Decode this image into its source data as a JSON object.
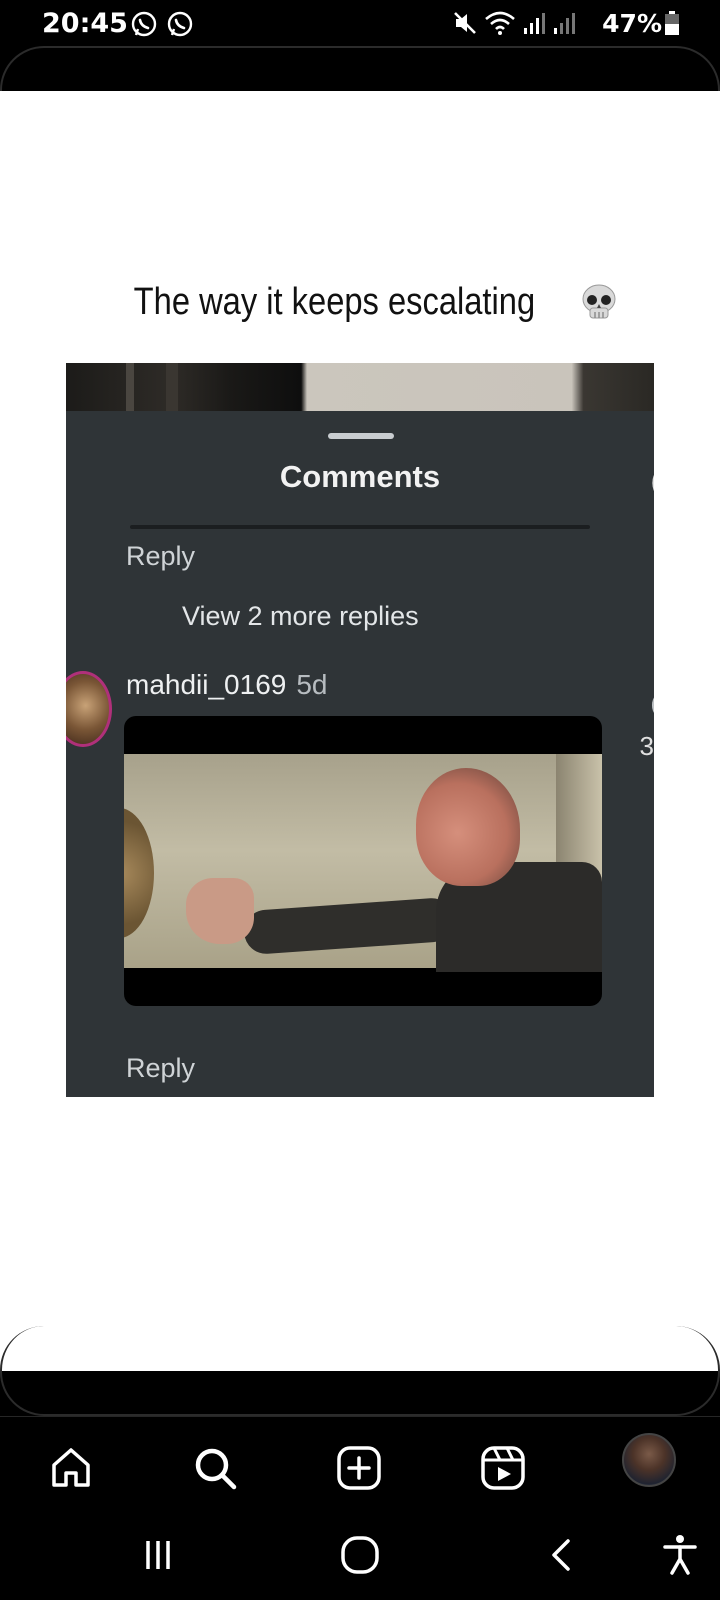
{
  "status_bar": {
    "time": "20:45",
    "battery_percent": "47%"
  },
  "post": {
    "caption": "The way it keeps escalating",
    "caption_emoji": "skull-emoji"
  },
  "embedded_screenshot": {
    "sheet_title": "Comments",
    "reply_label_1": "Reply",
    "view_more_replies": "View 2 more replies",
    "comment_username": "mahdii_0169",
    "comment_age": "5d",
    "reply_label_2": "Reply",
    "edge_fragments": [
      "(",
      "(",
      "3"
    ]
  },
  "bottom_nav": {
    "items": [
      "home-icon",
      "search-icon",
      "create-icon",
      "reels-icon",
      "profile-avatar"
    ]
  },
  "system_nav": {
    "items": [
      "recent-apps-icon",
      "home-circle-icon",
      "back-icon",
      "accessibility-icon"
    ]
  },
  "colors": {
    "background": "#000000",
    "content_bg": "#ffffff",
    "sheet_bg": "#2f3437",
    "ring_accent": "#b0307a"
  }
}
